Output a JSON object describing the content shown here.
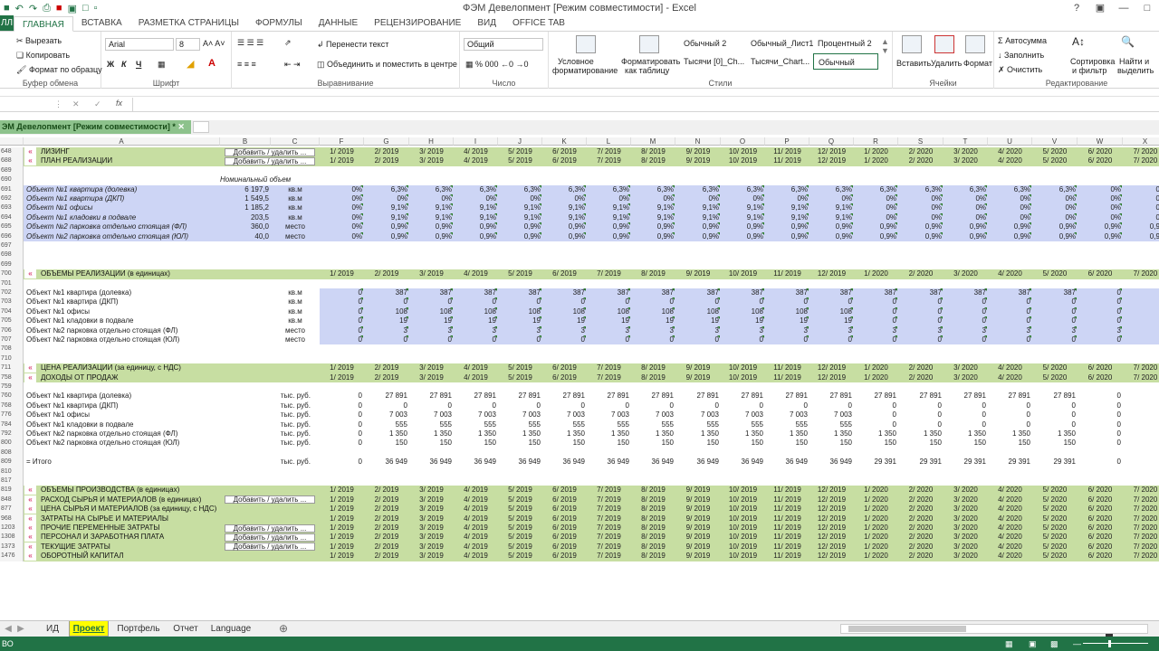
{
  "window": {
    "title": "ФЭМ Девелопмент  [Режим совместимости] - Excel"
  },
  "ribbon": {
    "file_tab": "ЛЛ",
    "tabs": [
      "ГЛАВНАЯ",
      "ВСТАВКА",
      "РАЗМЕТКА СТРАНИЦЫ",
      "ФОРМУЛЫ",
      "ДАННЫЕ",
      "РЕЦЕНЗИРОВАНИЕ",
      "ВИД",
      "OFFICE TAB"
    ],
    "clipboard": {
      "cut": "Вырезать",
      "copy": "Копировать",
      "format_painter": "Формат по образцу",
      "label": "Буфер обмена"
    },
    "font": {
      "name": "Arial",
      "size": "8",
      "label": "Шрифт"
    },
    "alignment": {
      "wrap": "Перенести текст",
      "merge": "Объединить и поместить в центре",
      "label": "Выравнивание"
    },
    "number": {
      "format": "Общий",
      "label": "Число"
    },
    "styles": {
      "cond1": "Условное",
      "cond2": "форматирование",
      "fmt1": "Форматировать",
      "fmt2": "как таблицу",
      "s1": "Обычный 2",
      "s2": "Обычный_Лист1",
      "s3": "Процентный 2",
      "s4": "Тысячи [0]_Ch...",
      "s5": "Тысячи_Chart...",
      "s6": "Обычный",
      "label": "Стили"
    },
    "cells": {
      "insert": "Вставить",
      "delete": "Удалить",
      "format": "Формат",
      "label": "Ячейки"
    },
    "editing": {
      "autosum": "Автосумма",
      "fill": "Заполнить",
      "clear": "Очистить",
      "sort1": "Сортировка",
      "sort2": "и фильтр",
      "find1": "Найти и",
      "find2": "выделить",
      "label": "Редактирование"
    }
  },
  "workbook_tab": "ЭМ Девелопмент  [Режим совместимости] *",
  "columns": [
    "A",
    "B",
    "C",
    "F",
    "G",
    "H",
    "I",
    "J",
    "K",
    "L",
    "M",
    "N",
    "O",
    "P",
    "Q",
    "R",
    "S",
    "T",
    "U",
    "V",
    "W",
    "X"
  ],
  "add_button": "Добавить / удалить ...",
  "months": [
    "1/ 2019",
    "2/ 2019",
    "3/ 2019",
    "4/ 2019",
    "5/ 2019",
    "6/ 2019",
    "7/ 2019",
    "8/ 2019",
    "9/ 2019",
    "10/ 2019",
    "11/ 2019",
    "12/ 2019",
    "1/ 2020",
    "2/ 2020",
    "3/ 2020",
    "4/ 2020",
    "5/ 2020",
    "6/ 2020",
    "7/ 2020"
  ],
  "rows": [
    {
      "n": "648",
      "t": "sec",
      "a": "ЛИЗИНГ",
      "btn": true
    },
    {
      "n": "688",
      "t": "sec",
      "a": "ПЛАН РЕАЛИЗАЦИИ",
      "btn": true
    },
    {
      "n": "689",
      "t": "blank"
    },
    {
      "n": "690",
      "t": "note",
      "b": "Номинальный объем"
    },
    {
      "n": "691",
      "t": "blue",
      "a": "Объект  №1 квартира (долевка)",
      "b": "6 197,9",
      "c": "кв.м",
      "v": [
        "0%",
        "6,3%",
        "6,3%",
        "6,3%",
        "6,3%",
        "6,3%",
        "6,3%",
        "6,3%",
        "6,3%",
        "6,3%",
        "6,3%",
        "6,3%",
        "6,3%",
        "6,3%",
        "6,3%",
        "6,3%",
        "6,3%",
        "0%",
        "0%"
      ]
    },
    {
      "n": "692",
      "t": "blue",
      "a": "Объект  №1 квартира (ДКП)",
      "b": "1 549,5",
      "c": "кв.м",
      "v": [
        "0%",
        "0%",
        "0%",
        "0%",
        "0%",
        "0%",
        "0%",
        "0%",
        "0%",
        "0%",
        "0%",
        "0%",
        "0%",
        "0%",
        "0%",
        "0%",
        "0%",
        "0%",
        "0%"
      ]
    },
    {
      "n": "693",
      "t": "blue",
      "a": "Объект  №1 офисы",
      "b": "1 185,2",
      "c": "кв.м",
      "v": [
        "0%",
        "9,1%",
        "9,1%",
        "9,1%",
        "9,1%",
        "9,1%",
        "9,1%",
        "9,1%",
        "9,1%",
        "9,1%",
        "9,1%",
        "9,1%",
        "0%",
        "0%",
        "0%",
        "0%",
        "0%",
        "0%",
        "0%"
      ]
    },
    {
      "n": "694",
      "t": "blue",
      "a": "Объект  №1 кладовки в подвале",
      "b": "203,5",
      "c": "кв.м",
      "v": [
        "0%",
        "9,1%",
        "9,1%",
        "9,1%",
        "9,1%",
        "9,1%",
        "9,1%",
        "9,1%",
        "9,1%",
        "9,1%",
        "9,1%",
        "9,1%",
        "0%",
        "0%",
        "0%",
        "0%",
        "0%",
        "0%",
        "0%"
      ]
    },
    {
      "n": "695",
      "t": "blue",
      "a": "Объект №2 парковка отдельно стоящая (ФЛ)",
      "b": "360,0",
      "c": "место",
      "v": [
        "0%",
        "0,9%",
        "0,9%",
        "0,9%",
        "0,9%",
        "0,9%",
        "0,9%",
        "0,9%",
        "0,9%",
        "0,9%",
        "0,9%",
        "0,9%",
        "0,9%",
        "0,9%",
        "0,9%",
        "0,9%",
        "0,9%",
        "0,9%",
        "0,9%"
      ]
    },
    {
      "n": "696",
      "t": "blue",
      "a": "Объект №2 парковка отдельно стоящая (ЮЛ)",
      "b": "40,0",
      "c": "место",
      "v": [
        "0%",
        "0,9%",
        "0,9%",
        "0,9%",
        "0,9%",
        "0,9%",
        "0,9%",
        "0,9%",
        "0,9%",
        "0,9%",
        "0,9%",
        "0,9%",
        "0,9%",
        "0,9%",
        "0,9%",
        "0,9%",
        "0,9%",
        "0,9%",
        "0,9%"
      ]
    },
    {
      "n": "697",
      "t": "blank"
    },
    {
      "n": "698",
      "t": "blank"
    },
    {
      "n": "699",
      "t": "blank"
    },
    {
      "n": "700",
      "t": "sec",
      "a": "ОБЪЕМЫ РЕАЛИЗАЦИИ (в единицах)"
    },
    {
      "n": "701",
      "t": "blank"
    },
    {
      "n": "702",
      "t": "blue2",
      "a": "Объект  №1 квартира (долевка)",
      "c": "кв.м",
      "v": [
        "0",
        "387",
        "387",
        "387",
        "387",
        "387",
        "387",
        "387",
        "387",
        "387",
        "387",
        "387",
        "387",
        "387",
        "387",
        "387",
        "387",
        "0",
        "0"
      ]
    },
    {
      "n": "703",
      "t": "blue2",
      "a": "Объект  №1 квартира (ДКП)",
      "c": "кв.м",
      "v": [
        "0",
        "0",
        "0",
        "0",
        "0",
        "0",
        "0",
        "0",
        "0",
        "0",
        "0",
        "0",
        "0",
        "0",
        "0",
        "0",
        "0",
        "0",
        "0"
      ]
    },
    {
      "n": "704",
      "t": "blue2",
      "a": "Объект  №1 офисы",
      "c": "кв.м",
      "v": [
        "0",
        "108",
        "108",
        "108",
        "108",
        "108",
        "108",
        "108",
        "108",
        "108",
        "108",
        "108",
        "0",
        "0",
        "0",
        "0",
        "0",
        "0",
        "0"
      ]
    },
    {
      "n": "705",
      "t": "blue2",
      "a": "Объект  №1 кладовки в подвале",
      "c": "кв.м",
      "v": [
        "0",
        "19",
        "19",
        "19",
        "19",
        "19",
        "19",
        "19",
        "19",
        "19",
        "19",
        "19",
        "0",
        "0",
        "0",
        "0",
        "0",
        "0",
        "0"
      ]
    },
    {
      "n": "706",
      "t": "blue2",
      "a": "Объект №2 парковка отдельно стоящая (ФЛ)",
      "c": "место",
      "v": [
        "0",
        "3",
        "3",
        "3",
        "3",
        "3",
        "3",
        "3",
        "3",
        "3",
        "3",
        "3",
        "3",
        "3",
        "3",
        "3",
        "3",
        "3",
        "3"
      ]
    },
    {
      "n": "707",
      "t": "blue2",
      "a": "Объект №2 парковка отдельно стоящая (ЮЛ)",
      "c": "место",
      "v": [
        "0",
        "0",
        "0",
        "0",
        "0",
        "0",
        "0",
        "0",
        "0",
        "0",
        "0",
        "0",
        "0",
        "0",
        "0",
        "0",
        "0",
        "0",
        "0"
      ]
    },
    {
      "n": "708",
      "t": "blank"
    },
    {
      "n": "710",
      "t": "blank"
    },
    {
      "n": "711",
      "t": "sec",
      "a": "ЦЕНА РЕАЛИЗАЦИИ (за единицу, с НДС)"
    },
    {
      "n": "758",
      "t": "sec",
      "a": "ДОХОДЫ ОТ ПРОДАЖ"
    },
    {
      "n": "759",
      "t": "blank"
    },
    {
      "n": "760",
      "t": "plain",
      "a": "Объект  №1 квартира (долевка)",
      "c": "тыс. руб.",
      "v": [
        "0",
        "27 891",
        "27 891",
        "27 891",
        "27 891",
        "27 891",
        "27 891",
        "27 891",
        "27 891",
        "27 891",
        "27 891",
        "27 891",
        "27 891",
        "27 891",
        "27 891",
        "27 891",
        "27 891",
        "0",
        ""
      ]
    },
    {
      "n": "768",
      "t": "plain",
      "a": "Объект  №1 квартира (ДКП)",
      "c": "тыс. руб.",
      "v": [
        "0",
        "0",
        "0",
        "0",
        "0",
        "0",
        "0",
        "0",
        "0",
        "0",
        "0",
        "0",
        "0",
        "0",
        "0",
        "0",
        "0",
        "0",
        ""
      ]
    },
    {
      "n": "776",
      "t": "plain",
      "a": "Объект  №1 офисы",
      "c": "тыс. руб.",
      "v": [
        "0",
        "7 003",
        "7 003",
        "7 003",
        "7 003",
        "7 003",
        "7 003",
        "7 003",
        "7 003",
        "7 003",
        "7 003",
        "7 003",
        "0",
        "0",
        "0",
        "0",
        "0",
        "0",
        ""
      ]
    },
    {
      "n": "784",
      "t": "plain",
      "a": "Объект  №1 кладовки в подвале",
      "c": "тыс. руб.",
      "v": [
        "0",
        "555",
        "555",
        "555",
        "555",
        "555",
        "555",
        "555",
        "555",
        "555",
        "555",
        "555",
        "0",
        "0",
        "0",
        "0",
        "0",
        "0",
        ""
      ]
    },
    {
      "n": "792",
      "t": "plain",
      "a": "Объект №2 парковка отдельно стоящая (ФЛ)",
      "c": "тыс. руб.",
      "v": [
        "0",
        "1 350",
        "1 350",
        "1 350",
        "1 350",
        "1 350",
        "1 350",
        "1 350",
        "1 350",
        "1 350",
        "1 350",
        "1 350",
        "1 350",
        "1 350",
        "1 350",
        "1 350",
        "1 350",
        "0",
        ""
      ]
    },
    {
      "n": "800",
      "t": "plain",
      "a": "Объект №2 парковка отдельно стоящая (ЮЛ)",
      "c": "тыс. руб.",
      "v": [
        "0",
        "150",
        "150",
        "150",
        "150",
        "150",
        "150",
        "150",
        "150",
        "150",
        "150",
        "150",
        "150",
        "150",
        "150",
        "150",
        "150",
        "0",
        ""
      ]
    },
    {
      "n": "808",
      "t": "blank"
    },
    {
      "n": "809",
      "t": "plain",
      "a": "= Итого",
      "c": "тыс. руб.",
      "v": [
        "0",
        "36 949",
        "36 949",
        "36 949",
        "36 949",
        "36 949",
        "36 949",
        "36 949",
        "36 949",
        "36 949",
        "36 949",
        "36 949",
        "29 391",
        "29 391",
        "29 391",
        "29 391",
        "29 391",
        "0",
        ""
      ]
    },
    {
      "n": "810",
      "t": "blank"
    },
    {
      "n": "817",
      "t": "blank"
    },
    {
      "n": "819",
      "t": "sec",
      "a": "ОБЪЕМЫ ПРОИЗВОДСТВА (в единицах)"
    },
    {
      "n": "848",
      "t": "sec",
      "a": "РАСХОД СЫРЬЯ И МАТЕРИАЛОВ (в единицах)",
      "btn": true
    },
    {
      "n": "877",
      "t": "sec",
      "a": "ЦЕНА СЫРЬЯ И МАТЕРИАЛОВ (за единицу, с НДС)"
    },
    {
      "n": "968",
      "t": "sec",
      "a": "ЗАТРАТЫ НА СЫРЬЕ И МАТЕРИАЛЫ"
    },
    {
      "n": "1203",
      "t": "sec",
      "a": "ПРОЧИЕ ПЕРЕМЕННЫЕ ЗАТРАТЫ",
      "btn": true
    },
    {
      "n": "1308",
      "t": "sec",
      "a": "ПЕРСОНАЛ И ЗАРАБОТНАЯ ПЛАТА",
      "btn": true
    },
    {
      "n": "1373",
      "t": "sec",
      "a": "ТЕКУЩИЕ ЗАТРАТЫ",
      "btn": true
    },
    {
      "n": "1476",
      "t": "sec",
      "a": "ОБОРОТНЫЙ КАПИТАЛ"
    }
  ],
  "sheets": [
    "ИД",
    "Проект",
    "Портфель",
    "Отчет",
    "Language"
  ],
  "active_sheet": "Проект",
  "status": {
    "left": "ВО"
  }
}
